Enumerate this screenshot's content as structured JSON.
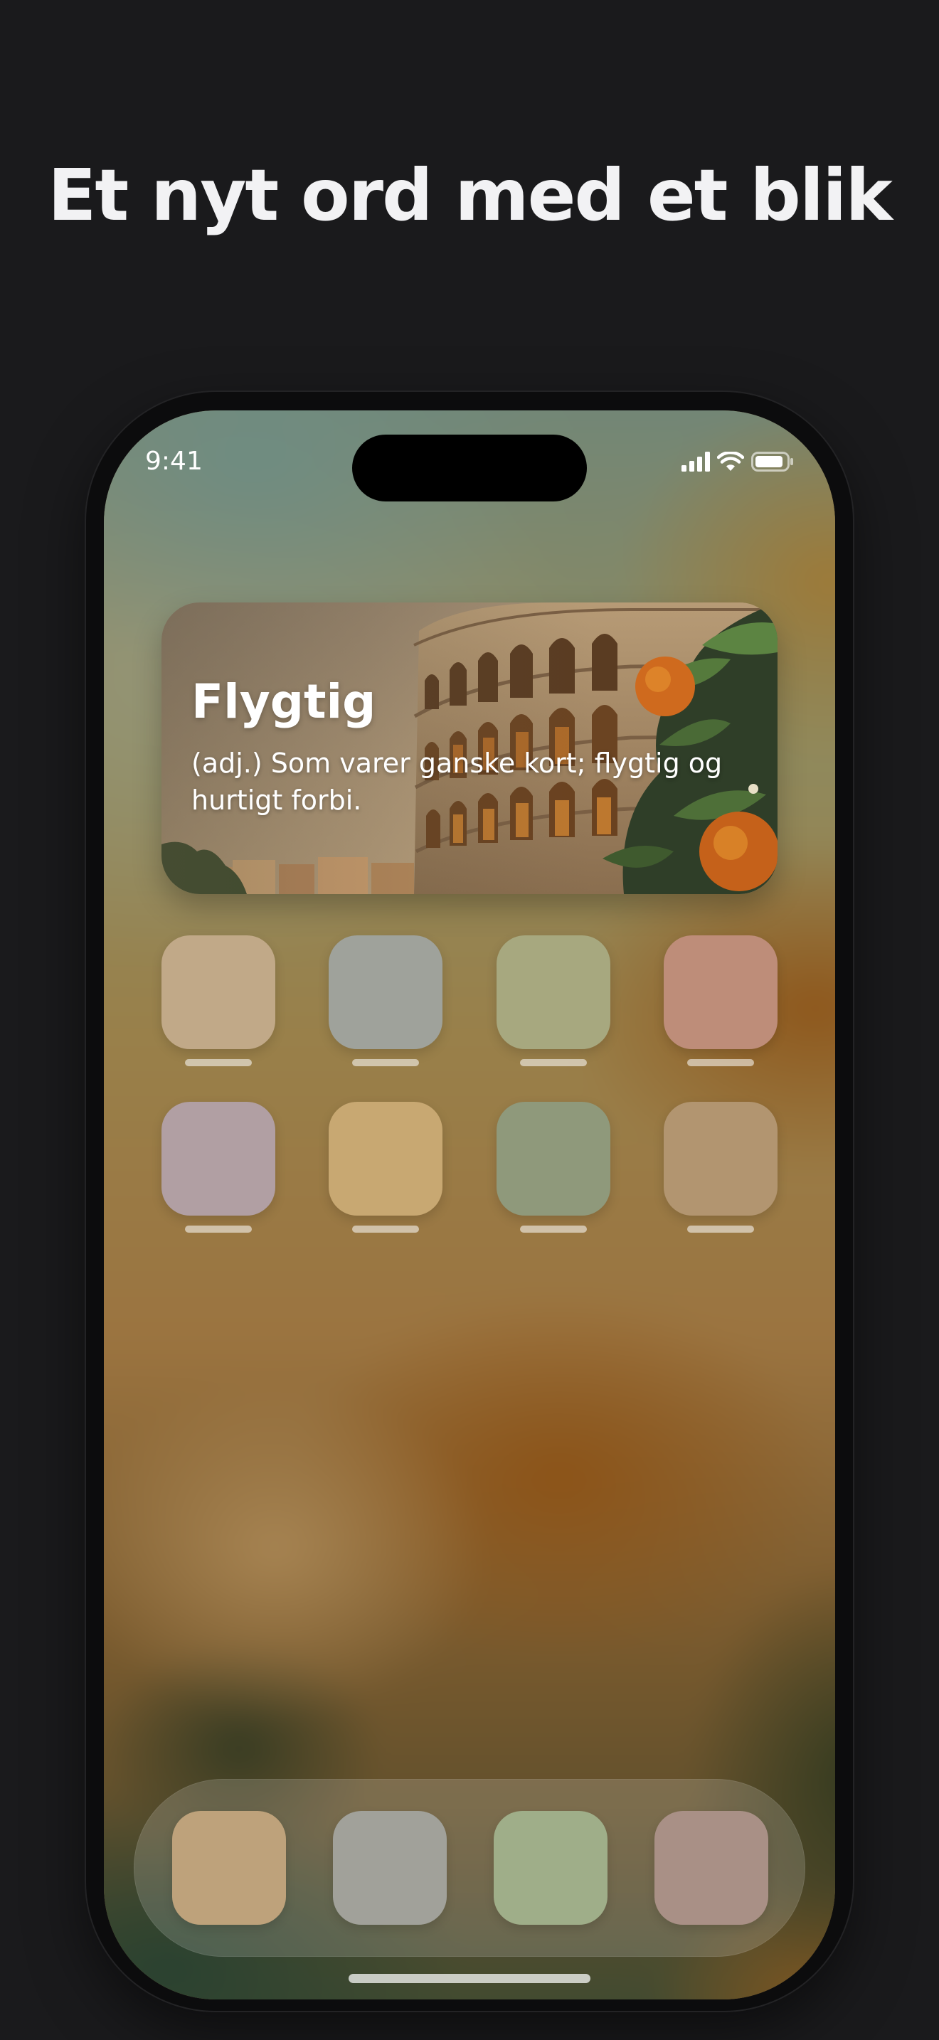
{
  "headline": "Et nyt ord med et blik",
  "status_bar": {
    "time": "9:41",
    "icons": [
      "cellular-signal-icon",
      "wifi-icon",
      "battery-icon"
    ]
  },
  "widget": {
    "word": "Flygtig",
    "definition": "(adj.) Som varer ganske kort; flygtig og hurtigt forbi."
  },
  "home_grid": {
    "rows": [
      [
        {
          "color": "#c1a988"
        },
        {
          "color": "#9fa29b"
        },
        {
          "color": "#a7a87f"
        },
        {
          "color": "#be8d79"
        }
      ],
      [
        {
          "color": "#b19fa3"
        },
        {
          "color": "#c8a872"
        },
        {
          "color": "#8f997b"
        },
        {
          "color": "#b29570"
        }
      ]
    ]
  },
  "dock": {
    "apps": [
      {
        "color": "#bea27b"
      },
      {
        "color": "#a1a19a"
      },
      {
        "color": "#9fae89"
      },
      {
        "color": "#a99086"
      }
    ]
  }
}
